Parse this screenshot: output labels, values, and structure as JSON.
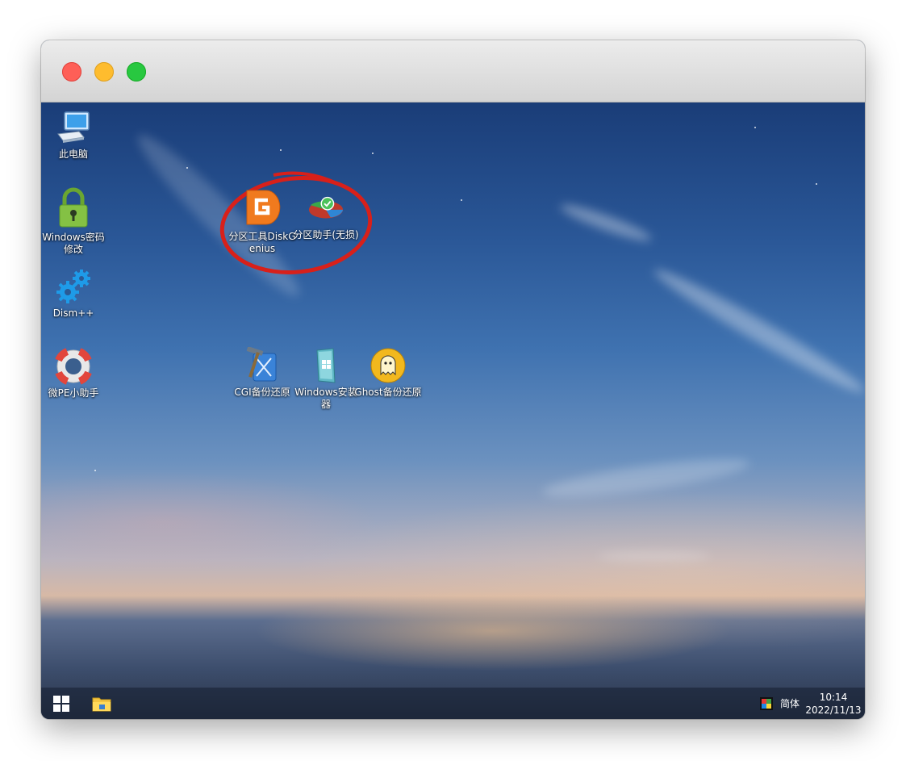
{
  "desktop": {
    "icons": [
      {
        "label": "此电脑",
        "icon": "computer-icon"
      },
      {
        "label": "Windows密码修改",
        "icon": "padlock-icon"
      },
      {
        "label": "Dism++",
        "icon": "gears-icon"
      },
      {
        "label": "微PE小助手",
        "icon": "lifebuoy-icon"
      },
      {
        "label": "分区工具DiskGenius",
        "icon": "diskgenius-icon"
      },
      {
        "label": "分区助手(无损)",
        "icon": "partition-assistant-icon"
      },
      {
        "label": "CGI备份还原",
        "icon": "cgi-backup-icon"
      },
      {
        "label": "Windows安装器",
        "icon": "windows-installer-icon"
      },
      {
        "label": "Ghost备份还原",
        "icon": "ghost-icon"
      }
    ],
    "annotation_color": "#d8201a"
  },
  "taskbar": {
    "start_icon": "windows-logo-icon",
    "explorer_icon": "file-explorer-icon",
    "ime_icon": "color-square-icon",
    "language": "简体",
    "time": "10:14",
    "date": "2022/11/13"
  },
  "window": {
    "traffic_lights": [
      "#fe5f57",
      "#febc2e",
      "#28c840"
    ]
  }
}
